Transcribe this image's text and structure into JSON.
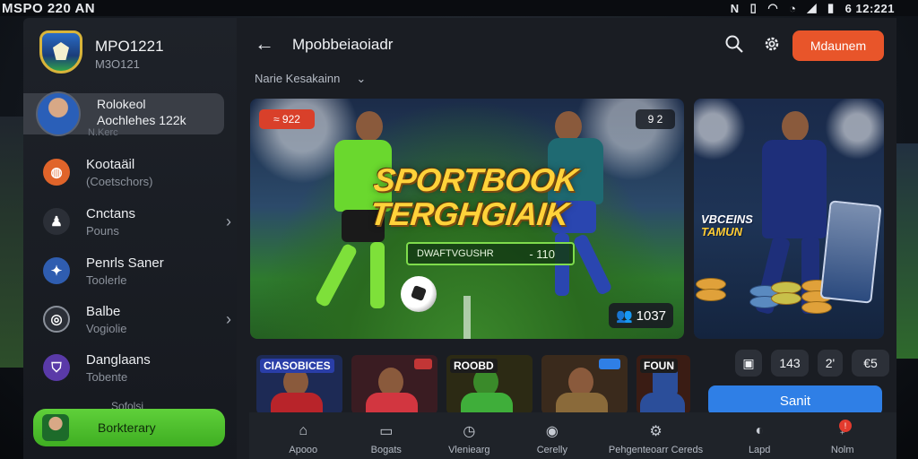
{
  "status_bar": {
    "left_text": "MSPO 220 AN",
    "right_text": "6 12:221",
    "icons": [
      "n-icon",
      "sim-icon",
      "wifi-icon",
      "signal-icon",
      "battery-icon"
    ]
  },
  "sidebar": {
    "brand": {
      "title": "MPO1221",
      "subtitle": "M3O121"
    },
    "profile": {
      "line1": "Rolokeol",
      "line2": "Aochlehes 122k",
      "sub": "N.Kerc"
    },
    "items": [
      {
        "label": "Kootaäil",
        "sub": "(Coetschors)",
        "icon": "ball-icon",
        "color": "#e0642a",
        "chevron": false
      },
      {
        "label": "Cnctans",
        "sub": "Pouns",
        "icon": "players-icon",
        "color": "#2b2f37",
        "chevron": true
      },
      {
        "label": "Penrls Saner",
        "sub": "Toolerle",
        "icon": "crest-icon",
        "color": "#2f5db0",
        "chevron": false
      },
      {
        "label": "Balbe",
        "sub": "Vogiolie",
        "icon": "ball-outline-icon",
        "color": "#2b2f37",
        "chevron": true
      },
      {
        "label": "Danglaans",
        "sub": "Tobente",
        "icon": "shield-icon",
        "color": "#5a3aa8",
        "chevron": false
      }
    ],
    "footer_label": "Sofolsi",
    "active_button": "Borkterary"
  },
  "topbar": {
    "title": "Mpobbeiaoiadr",
    "cta": "Mdaunem",
    "filter": "Narie Kesakainn"
  },
  "hero": {
    "tag_left": "≈ 922",
    "tag_right": "9 2",
    "title_line1": "SPORTBOOK",
    "title_line2": "TERGHGIAIK",
    "bar_label": "DWAFTVGUSHR",
    "bar_value": "- 110",
    "count": "1037"
  },
  "side_card": {
    "label_line1": "VBCEINS",
    "label_line2": "TAMUN"
  },
  "thumbnails": [
    {
      "caption": "CIASOBICES",
      "cap_color": "#2a3ea8",
      "bg": "#1d2a55",
      "shirt": "#b8242a"
    },
    {
      "caption": "",
      "cap_color": "#c23636",
      "bg": "#3a1c22",
      "shirt": "#d23640"
    },
    {
      "caption": "ROOBD",
      "cap_color": "#1c1c1c",
      "bg": "#2c2a14",
      "shirt": "#3fae3a"
    },
    {
      "caption": "",
      "cap_color": "#2f7fe6",
      "bg": "#3a2a1c",
      "shirt": "#8a6a3a"
    },
    {
      "caption": "FOUN",
      "cap_color": "#1c1c1c",
      "bg": "#3a1c14",
      "shirt": "#2b4e9a"
    }
  ],
  "stats": [
    "",
    "143",
    "2'",
    "€5"
  ],
  "send_button": "Sanit",
  "bottom_nav": [
    {
      "label": "Apooo",
      "icon": "home-icon"
    },
    {
      "label": "Bogats",
      "icon": "screen-icon"
    },
    {
      "label": "Vleniearg",
      "icon": "clock-icon"
    },
    {
      "label": "Cerelly",
      "icon": "ball-icon"
    },
    {
      "label": "Pehgenteoarr Cereds",
      "icon": "cards-icon"
    },
    {
      "label": "Lapd",
      "icon": "globe-icon"
    },
    {
      "label": "Nolm",
      "icon": "bell-icon",
      "badge": "!"
    }
  ]
}
